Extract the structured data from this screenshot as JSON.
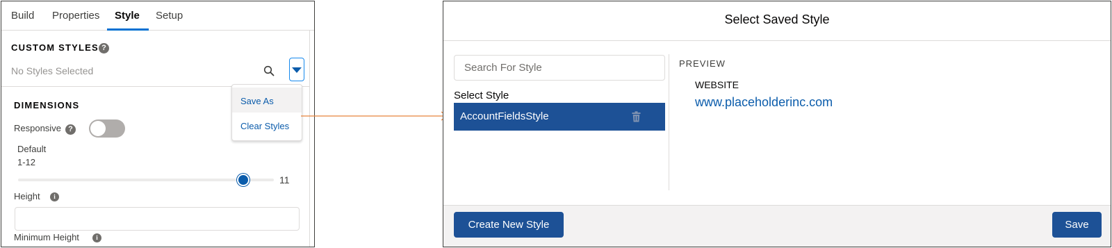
{
  "left_panel": {
    "tabs": [
      {
        "label": "Build"
      },
      {
        "label": "Properties"
      },
      {
        "label": "Style"
      },
      {
        "label": "Setup"
      }
    ],
    "active_tab": "Style",
    "custom_styles": {
      "title": "CUSTOM STYLES",
      "value": "No Styles Selected",
      "menu": [
        {
          "label": "Save As"
        },
        {
          "label": "Clear Styles"
        }
      ]
    },
    "dimensions": {
      "title": "DIMENSIONS",
      "responsive_label": "Responsive",
      "responsive_on": false,
      "default_label": "Default",
      "range_label": "1-12",
      "slider_value": "11",
      "slider_min": 1,
      "slider_max": 12,
      "height_label": "Height",
      "height_value": "",
      "min_height_label": "Minimum Height"
    }
  },
  "modal": {
    "title": "Select Saved Style",
    "search_placeholder": "Search For Style",
    "select_label": "Select Style",
    "styles": [
      {
        "label": "AccountFieldsStyle",
        "selected": true
      }
    ],
    "preview": {
      "title": "PREVIEW",
      "field_label": "WEBSITE",
      "field_value": "www.placeholderinc.com"
    },
    "footer": {
      "create_label": "Create New Style",
      "save_label": "Save"
    }
  },
  "colors": {
    "brand_blue": "#1d5196",
    "link_blue": "#0b5cab",
    "connector_orange": "#e8843c"
  }
}
